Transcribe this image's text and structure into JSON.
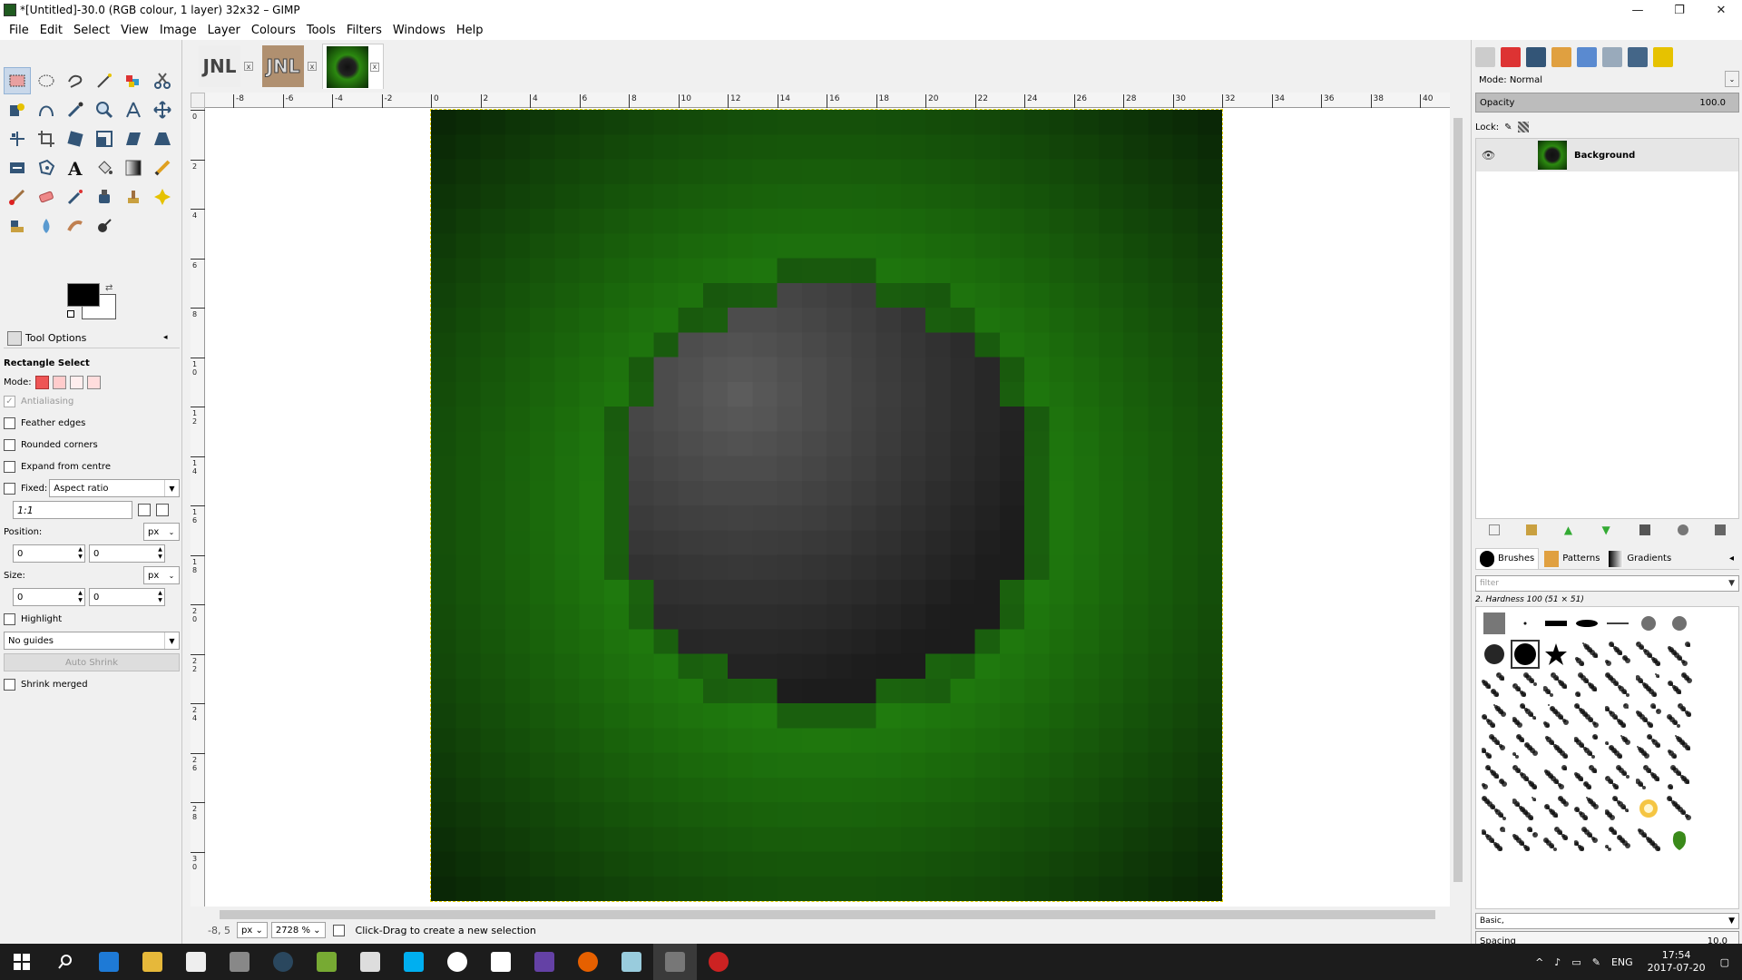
{
  "window": {
    "title": "*[Untitled]-30.0 (RGB colour, 1 layer) 32x32 – GIMP",
    "minimize": "—",
    "maximize": "❐",
    "close": "✕"
  },
  "menu": [
    "File",
    "Edit",
    "Select",
    "View",
    "Image",
    "Layer",
    "Colours",
    "Tools",
    "Filters",
    "Windows",
    "Help"
  ],
  "image_tabs": [
    {
      "label": "JNL",
      "close": "x"
    },
    {
      "label": "JNL",
      "close": "x"
    },
    {
      "label": "",
      "close": "x"
    }
  ],
  "tool_options": {
    "tab_label": "Tool Options",
    "tool_name": "Rectangle Select",
    "mode_label": "Mode:",
    "antialiasing": "Antialiasing",
    "feather_edges": "Feather edges",
    "rounded_corners": "Rounded corners",
    "expand_from_centre": "Expand from centre",
    "fixed_label": "Fixed:",
    "fixed_value": "Aspect ratio",
    "ratio_value": "1:1",
    "position_label": "Position:",
    "position_unit": "px",
    "position_x": "0",
    "position_y": "0",
    "size_label": "Size:",
    "size_unit": "px",
    "size_w": "0",
    "size_h": "0",
    "highlight": "Highlight",
    "guides_value": "No guides",
    "auto_shrink": "Auto Shrink",
    "shrink_merged": "Shrink merged"
  },
  "ruler": {
    "h_ticks": [
      "-8",
      "-6",
      "-4",
      "-2",
      "0",
      "2",
      "4",
      "6",
      "8",
      "10",
      "12",
      "14",
      "16",
      "18",
      "20",
      "22",
      "24",
      "26",
      "28",
      "30",
      "32",
      "34",
      "36",
      "38",
      "40"
    ],
    "v_ticks": [
      "0",
      "2",
      "4",
      "6",
      "8",
      "10",
      "12",
      "14",
      "16",
      "18",
      "20",
      "22",
      "24",
      "26",
      "28",
      "30"
    ]
  },
  "status": {
    "coords": "-8, 5",
    "unit": "px",
    "zoom": "2728 %",
    "message": "Click-Drag to create a new selection"
  },
  "layers": {
    "mode_label": "Mode:",
    "mode_value": "Normal",
    "opacity_label": "Opacity",
    "opacity_value": "100.0",
    "lock_label": "Lock:",
    "items": [
      {
        "name": "Background",
        "visible": true
      }
    ]
  },
  "brushes": {
    "tabs": [
      "Brushes",
      "Patterns",
      "Gradients"
    ],
    "filter_placeholder": "filter",
    "selected_info": "2. Hardness 100 (51 × 51)",
    "set_value": "Basic,",
    "spacing_label": "Spacing",
    "spacing_value": "10.0"
  },
  "taskbar": {
    "lang": "ENG",
    "time": "17:54",
    "date": "2017-07-20"
  },
  "colors": {
    "foreground": "#000000",
    "background": "#ffffff",
    "selection_outline": "#e6d400"
  },
  "pixel_image": {
    "width": 32,
    "height": 32,
    "description_colors": {
      "outer": "#0a2606",
      "mid": "#2a9412",
      "sphere_light": "#585858",
      "sphere_dark": "#262626"
    }
  }
}
